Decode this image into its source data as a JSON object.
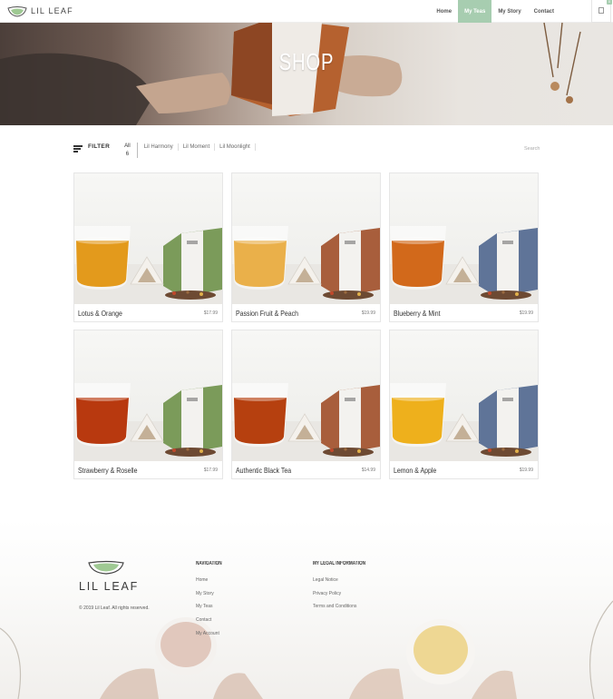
{
  "header": {
    "brand": "LIL LEAF",
    "nav": [
      "Home",
      "My Teas",
      "My Story",
      "Contact"
    ],
    "active_nav": "My Teas",
    "cart_count": "0"
  },
  "hero": {
    "title": "SHOP"
  },
  "filter": {
    "label": "FILTER",
    "all_label": "All",
    "all_count": "6",
    "categories": [
      "Lil Harmony",
      "Lil Moment",
      "Lil Moonlight"
    ],
    "search_placeholder": "Search"
  },
  "products": [
    {
      "name": "Lotus & Orange",
      "price": "$17.99",
      "tea_color": "#e39a1c",
      "box_color": "#7b9b5a"
    },
    {
      "name": "Passion Fruit & Peach",
      "price": "$19.99",
      "tea_color": "#eab04a",
      "box_color": "#a85e3c"
    },
    {
      "name": "Blueberry & Mint",
      "price": "$19.99",
      "tea_color": "#d2691b",
      "box_color": "#5f7498"
    },
    {
      "name": "Strawberry & Roselle",
      "price": "$17.99",
      "tea_color": "#b8390f",
      "box_color": "#7b9b5a"
    },
    {
      "name": "Authentic Black Tea",
      "price": "$14.99",
      "tea_color": "#b6400f",
      "box_color": "#a85e3c"
    },
    {
      "name": "Lemon & Apple",
      "price": "$19.99",
      "tea_color": "#eeb01c",
      "box_color": "#5f7498"
    }
  ],
  "footer": {
    "brand": "LIL LEAF",
    "copyright": "© 2019 Lil Leaf. All rights reserved.",
    "navigation_title": "NAVIGATION",
    "navigation_links": [
      "Home",
      "My Story",
      "My Teas",
      "Contact",
      "My Account"
    ],
    "legal_title": "MY LEGAL INFORMATION",
    "legal_links": [
      "Legal Notice",
      "Privacy Policy",
      "Terms and Conditions"
    ]
  },
  "colors": {
    "accent": "#a7cdb0",
    "text": "#333333"
  }
}
